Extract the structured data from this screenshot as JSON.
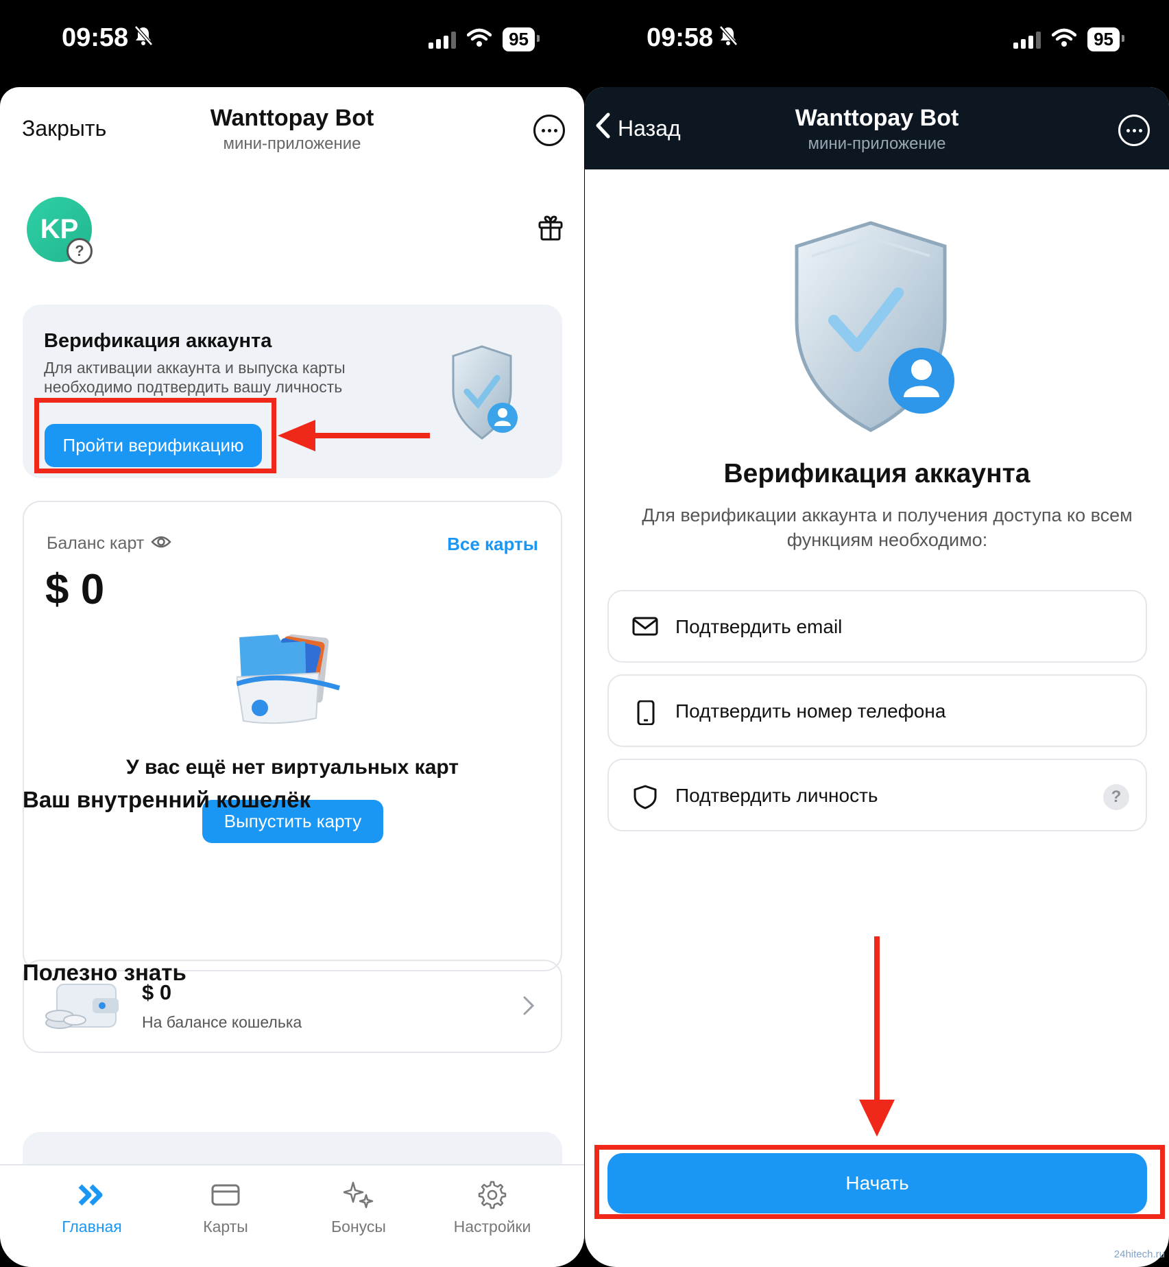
{
  "status": {
    "time": "09:58",
    "battery": "95"
  },
  "left": {
    "header": {
      "close_label": "Закрыть",
      "title": "Wanttopay Bot",
      "subtitle": "мини-приложение"
    },
    "avatar_initials": "KP",
    "avatar_badge": "?",
    "verify": {
      "title": "Верификация аккаунта",
      "description": "Для активации аккаунта и выпуска карты необходимо подтвердить вашу личность",
      "button": "Пройти верификацию"
    },
    "balance": {
      "label": "Баланс карт",
      "all_cards": "Все карты",
      "amount": "$ 0",
      "empty": "У вас ещё нет виртуальных карт",
      "issue_button": "Выпустить карту"
    },
    "wallet": {
      "heading": "Ваш внутренний кошелёк",
      "amount": "$ 0",
      "subtitle": "На балансе кошелька"
    },
    "useful_heading": "Полезно знать",
    "tabs": [
      {
        "label": "Главная",
        "icon": "chevrons-right-icon",
        "active": true
      },
      {
        "label": "Карты",
        "icon": "card-icon",
        "active": false
      },
      {
        "label": "Бонусы",
        "icon": "sparkles-icon",
        "active": false
      },
      {
        "label": "Настройки",
        "icon": "gear-icon",
        "active": false
      }
    ]
  },
  "right": {
    "header": {
      "back_label": "Назад",
      "title": "Wanttopay Bot",
      "subtitle": "мини-приложение"
    },
    "title": "Верификация аккаунта",
    "description": "Для верификации аккаунта и получения доступа ко всем функциям необходимо:",
    "steps": [
      {
        "label": "Подтвердить email",
        "icon": "envelope-icon"
      },
      {
        "label": "Подтвердить номер телефона",
        "icon": "phone-icon"
      },
      {
        "label": "Подтвердить личность",
        "icon": "shield-icon",
        "help": "?"
      }
    ],
    "start_button": "Начать"
  },
  "colors": {
    "accent": "#1a97f5",
    "highlight": "#f0281a",
    "dark_header": "#0c1722"
  },
  "watermark": "24hitech.ru"
}
